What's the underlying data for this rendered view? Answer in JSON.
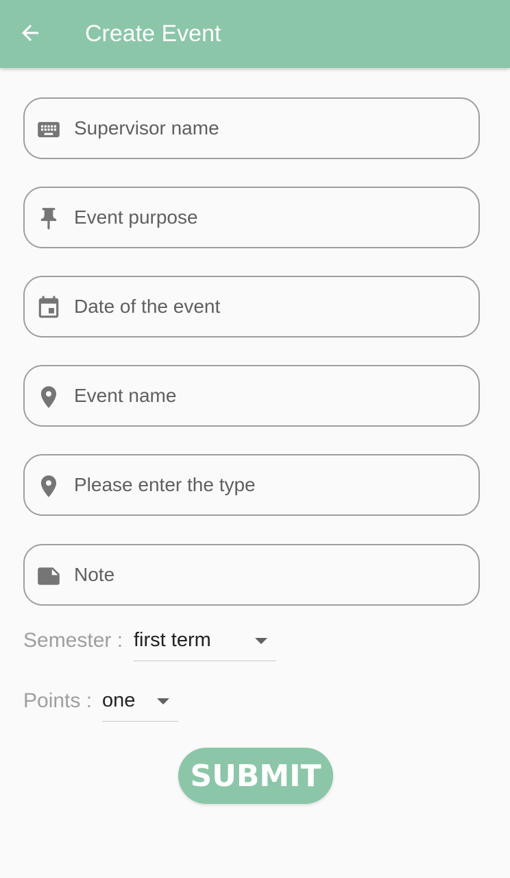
{
  "appbar": {
    "title": "Create Event",
    "back_icon": "arrow-back-icon",
    "color": "#8bc6a8"
  },
  "form": {
    "fields": [
      {
        "placeholder": "Supervisor name",
        "value": "",
        "icon": "keyboard-icon"
      },
      {
        "placeholder": "Event purpose",
        "value": "",
        "icon": "pin-icon"
      },
      {
        "placeholder": "Date of the event",
        "value": "",
        "icon": "calendar-icon"
      },
      {
        "placeholder": "Event name",
        "value": "",
        "icon": "location-pin-icon"
      },
      {
        "placeholder": "Please enter the type",
        "value": "",
        "icon": "location-pin-icon"
      },
      {
        "placeholder": "Note",
        "value": "",
        "icon": "note-icon"
      }
    ],
    "semester": {
      "label": "Semester :",
      "value": "first term"
    },
    "points": {
      "label": "Points :",
      "value": "one"
    },
    "submit_label": "SUBMIT"
  }
}
